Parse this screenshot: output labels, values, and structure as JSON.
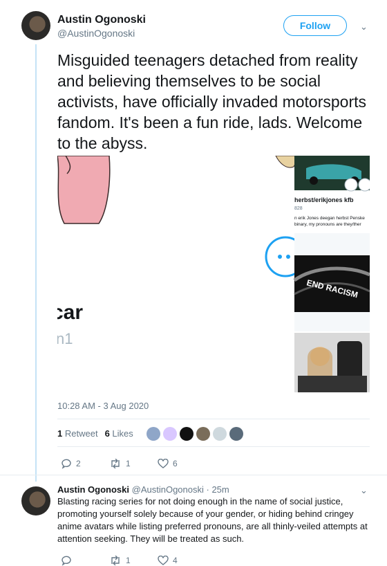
{
  "tweet": {
    "author_name": "Austin Ogonoski",
    "author_handle": "@AustinOgonoski",
    "follow_label": "Follow",
    "text": "Misguided teenagers detached from reality and believing themselves to be social activists, have officially invaded motorsports fandom. It's been a fun ride, lads. Welcome to the abyss.",
    "timestamp": "10:28 AM - 3 Aug 2020",
    "retweets_count": "1",
    "retweets_label": "Retweet",
    "likes_count": "6",
    "likes_label": "Likes",
    "actions": {
      "replies": "2",
      "retweets": "1",
      "likes": "6"
    }
  },
  "media": {
    "left_word": "car",
    "left_sub": "n1",
    "right_header": "herbst/erikjones kfb",
    "right_count": "828",
    "right_bio_1": "n erik Jones deegan herbst Penske",
    "right_bio_2": "binary, my pronouns are they/ther",
    "banner_text": "END RACISM"
  },
  "reply": {
    "author_name": "Austin Ogonoski",
    "author_handle": "@AustinOgonoski",
    "time": "· 25m",
    "text": "Blasting racing series for not doing enough in the name of social justice, promoting yourself solely because of your gender, or hiding behind cringey anime avatars while listing preferred pronouns, are all thinly-veiled attempts at attention seeking. They will be treated as such.",
    "actions": {
      "replies": "",
      "retweets": "1",
      "likes": "4"
    }
  },
  "icons": [
    "chevron-down-icon",
    "reply-icon",
    "retweet-icon",
    "like-icon"
  ],
  "colors": {
    "accent": "#1da1f2",
    "muted": "#657786",
    "thread_line": "#c4e3f6"
  }
}
